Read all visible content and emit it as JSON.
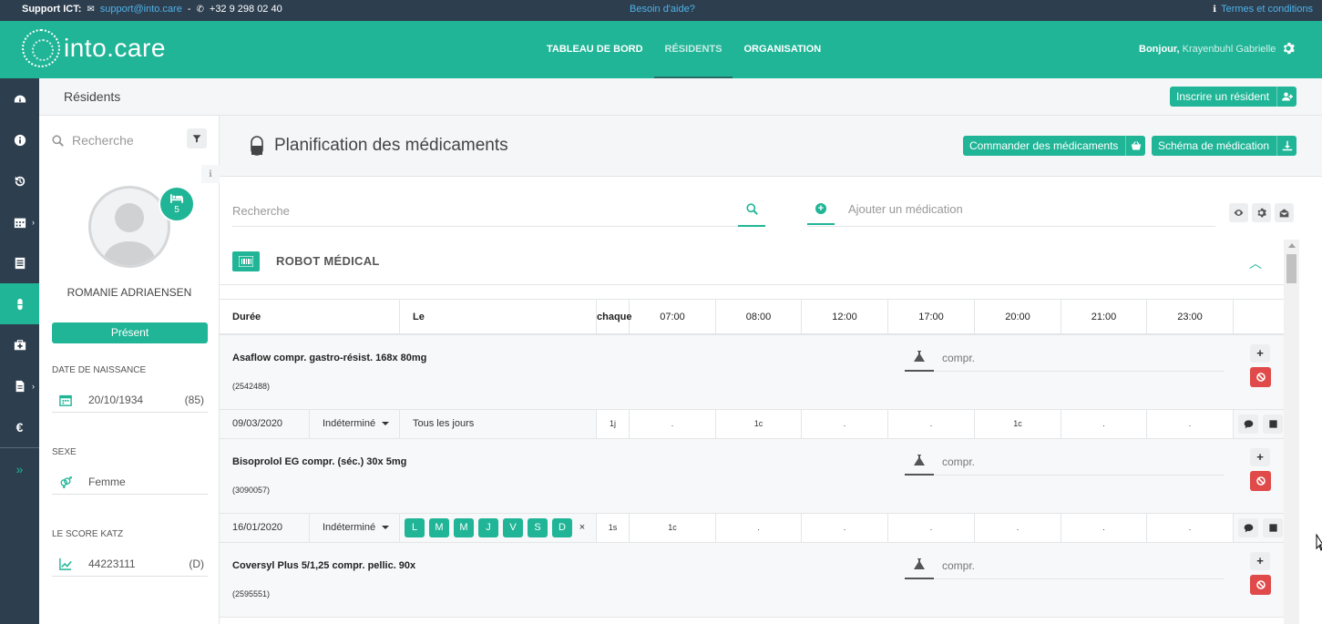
{
  "topbar": {
    "support_label": "Support ICT:",
    "email": "support@into.care",
    "separator": "-",
    "phone": "+32 9 298 02 40",
    "help": "Besoin d'aide?",
    "terms": "Termes et conditions"
  },
  "header": {
    "logo": "into.care",
    "nav": [
      "TABLEAU DE BORD",
      "RÉSIDENTS",
      "ORGANISATION"
    ],
    "active_nav": "RÉSIDENTS",
    "greeting": "Bonjour,",
    "user": "Krayenbuhl Gabrielle"
  },
  "sidebar": {
    "items": [
      "dashboard-icon",
      "info-icon",
      "history-icon",
      "calendar-icon",
      "list-icon",
      "pill-icon",
      "medkit-icon",
      "file-icon",
      "euro-icon",
      "expand-icon"
    ],
    "active": "pill-icon"
  },
  "breadcrumb": {
    "title": "Résidents",
    "register_button": "Inscrire un résident"
  },
  "resident": {
    "search_placeholder": "Recherche",
    "room": "5",
    "name": "ROMANIE ADRIAENSEN",
    "status": "Présent",
    "dob_label": "DATE DE NAISSANCE",
    "dob": "20/10/1934",
    "age": "(85)",
    "sex_label": "SEXE",
    "sex": "Femme",
    "katz_label": "LE SCORE KATZ",
    "katz": "44223111",
    "katz_class": "(D)"
  },
  "main": {
    "title": "Planification des médicaments",
    "order_button": "Commander des médicaments",
    "schema_button": "Schéma de médication",
    "search_placeholder": "Recherche",
    "add_placeholder": "Ajouter un médication",
    "section_title": "ROBOT MÉDICAL"
  },
  "table": {
    "headers": {
      "duration": "Durée",
      "on": "Le",
      "every": "chaque",
      "times": [
        "07:00",
        "08:00",
        "12:00",
        "17:00",
        "20:00",
        "21:00",
        "23:00"
      ]
    },
    "medications": [
      {
        "name": "Asaflow compr. gastro-résist. 168x 80mg",
        "code": "(2542488)",
        "unit": "compr.",
        "start": "09/03/2020",
        "duration": "Indéterminé",
        "frequency_text": "Tous les jours",
        "every": "1j",
        "doses": [
          ".",
          "1c",
          ".",
          ".",
          "1c",
          ".",
          "."
        ]
      },
      {
        "name": "Bisoprolol EG compr. (séc.) 30x 5mg",
        "code": "(3090057)",
        "unit": "compr.",
        "start": "16/01/2020",
        "duration": "Indéterminé",
        "days": [
          "L",
          "M",
          "M",
          "J",
          "V",
          "S",
          "D"
        ],
        "clear": "×",
        "every": "1s",
        "doses": [
          "1c",
          ".",
          ".",
          ".",
          ".",
          ".",
          "."
        ]
      },
      {
        "name": "Coversyl Plus 5/1,25 compr. pellic. 90x",
        "code": "(2595551)",
        "unit": "compr."
      }
    ]
  }
}
